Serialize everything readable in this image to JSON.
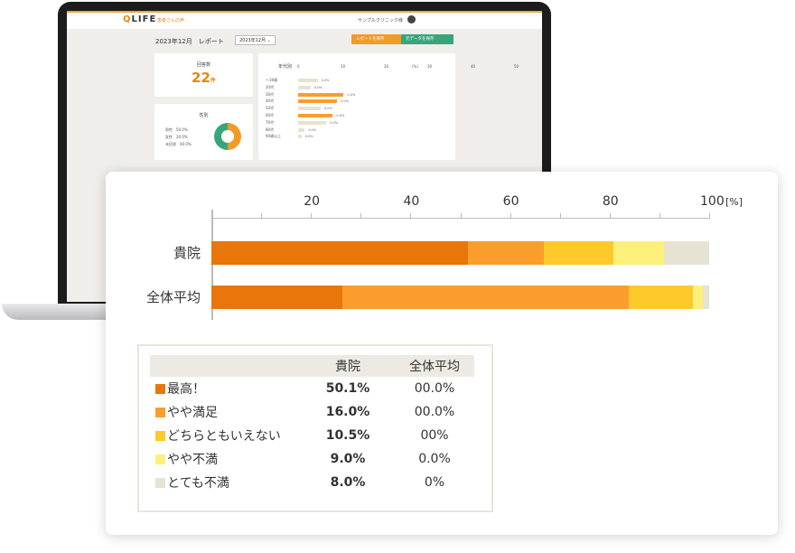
{
  "colors": {
    "best": "#e8760a",
    "somewhat_satisfied": "#f99e2c",
    "neutral": "#fdc92b",
    "somewhat_dissatisfied": "#fdf07a",
    "very_dissatisfied": "#e6e3d2",
    "brand_orange": "#e8860f",
    "brand_green": "#37a67b"
  },
  "laptop": {
    "logo_q": "Q",
    "logo_rest": "LIFE",
    "tagline": "患者さんの声",
    "clinic_name": "サンプルクリニック様",
    "report_title": "2023年12月　レポート",
    "month_select": "2023年12月",
    "save_report_button": "レポートを保存",
    "save_data_button": "元データを保存",
    "responses_label": "回答数",
    "responses_count": "22",
    "responses_unit": "件",
    "gender_label": "性別",
    "gender_items": [
      "男性　50.0%",
      "女性　20.0%",
      "未回答　00.0%"
    ],
    "age_label": "年代別",
    "age_ticks": [
      "0",
      "10",
      "20",
      "30",
      "40",
      "50"
    ],
    "age_unit": "(%)",
    "age_rows": [
      {
        "label": "〜19歳",
        "value": 4.5,
        "text": "0.0%"
      },
      {
        "label": "20代",
        "value": 2.9,
        "text": "0.0%"
      },
      {
        "label": "30代",
        "value": 10.5,
        "text": "0.0%"
      },
      {
        "label": "40代",
        "value": 9.0,
        "text": "0.0%"
      },
      {
        "label": "50代",
        "value": 5.2,
        "text": "0.0%"
      },
      {
        "label": "60代",
        "value": 8.0,
        "text": "0.0%"
      },
      {
        "label": "70代",
        "value": 6.5,
        "text": "0.0%"
      },
      {
        "label": "80代",
        "value": 1.5,
        "text": "0.0%"
      },
      {
        "label": "90歳以上",
        "value": 0.8,
        "text": "0.0%"
      }
    ]
  },
  "chart_data": {
    "type": "bar",
    "stacked": true,
    "orientation": "horizontal",
    "categories": [
      "貴院",
      "全体平均"
    ],
    "x_ticks": [
      "20",
      "40",
      "60",
      "80",
      "100"
    ],
    "x_unit": "[%]",
    "xlim": [
      0,
      100
    ],
    "series": [
      {
        "name": "最高！",
        "values": [
          51.5,
          26.3
        ]
      },
      {
        "name": "やや満足",
        "values": [
          15.2,
          57.5
        ]
      },
      {
        "name": "どちらともいえない",
        "values": [
          14.0,
          13.0
        ]
      },
      {
        "name": "やや不満",
        "values": [
          10.3,
          2.0
        ]
      },
      {
        "name": "とても不満",
        "values": [
          9.0,
          1.2
        ]
      }
    ]
  },
  "table": {
    "headers": [
      "",
      "貴院",
      "全体平均"
    ],
    "rows": [
      {
        "label": "最高！",
        "clinic": "50.1%",
        "average": "00.0%",
        "color": "#e8760a"
      },
      {
        "label": "やや満足",
        "clinic": "16.0%",
        "average": "00.0%",
        "color": "#f99e2c"
      },
      {
        "label": "どちらともいえない",
        "clinic": "10.5%",
        "average": "00%",
        "color": "#fdc92b"
      },
      {
        "label": "やや不満",
        "clinic": "9.0%",
        "average": "0.0%",
        "color": "#fdf07a"
      },
      {
        "label": "とても不満",
        "clinic": "8.0%",
        "average": "0%",
        "color": "#e6e3d2"
      }
    ]
  }
}
